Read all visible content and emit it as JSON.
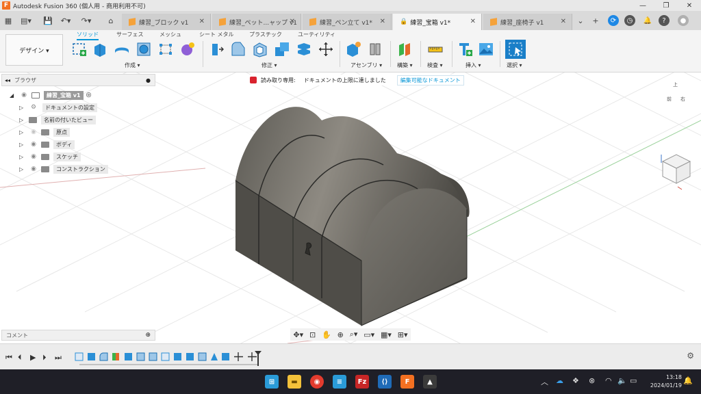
{
  "app": {
    "title": "Autodesk Fusion 360 (個人用 - 商用利用不可)",
    "logo": "F"
  },
  "tabs": [
    {
      "label": "練習_ブロック v1"
    },
    {
      "label": "練習_ペット...ャップ v1"
    },
    {
      "label": "練習_ペン立て v1*"
    },
    {
      "label": "練習_宝箱 v1*"
    },
    {
      "label": "練習_座椅子 v1"
    }
  ],
  "ribbon": {
    "workspace": "デザイン ▾",
    "tabs": [
      "ソリッド",
      "サーフェス",
      "メッシュ",
      "シート メタル",
      "プラスチック",
      "ユーティリティ"
    ],
    "groups": [
      "作成 ▾",
      "修正 ▾",
      "アセンブリ ▾",
      "構築 ▾",
      "検査 ▾",
      "挿入 ▾",
      "選択 ▾"
    ]
  },
  "browser": {
    "title": "ブラウザ",
    "root": "練習_宝箱 v1",
    "items": [
      {
        "label": "ドキュメントの設定"
      },
      {
        "label": "名前の付いたビュー"
      },
      {
        "label": "原点"
      },
      {
        "label": "ボディ"
      },
      {
        "label": "スケッチ"
      },
      {
        "label": "コンストラクション"
      }
    ]
  },
  "readonly": {
    "label": "読み取り専用:",
    "message": "ドキュメントの上限に達しました",
    "link": "編集可能なドキュメント"
  },
  "viewcube": {
    "top": "上",
    "front": "前",
    "right": "右"
  },
  "comment": {
    "label": "コメント"
  },
  "taskbar": {
    "time": "13:18",
    "date": "2024/01/19"
  }
}
